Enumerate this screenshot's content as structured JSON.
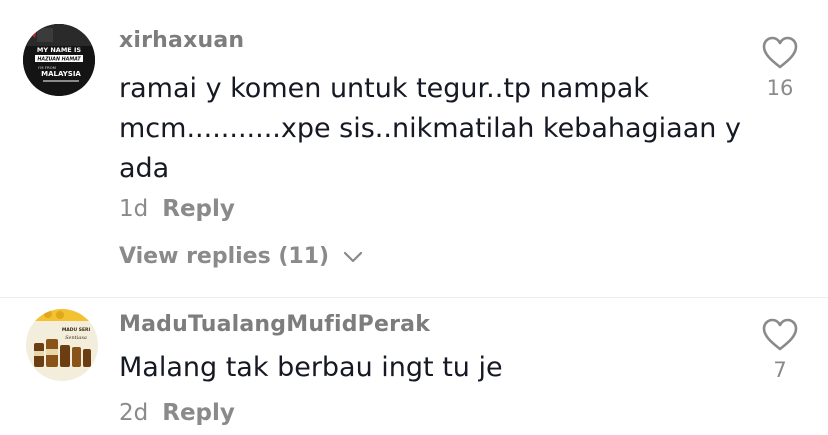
{
  "comments": [
    {
      "username": "xirhaxuan",
      "lines": [
        "ramai y komen untuk tegur..tp nampak",
        "mcm...........xpe sis..nikmatilah kebahagiaan y",
        "ada"
      ],
      "age": "1d",
      "reply_label": "Reply",
      "view_replies_label": "View replies (11)",
      "likes": "16",
      "avatar": {
        "lines": [
          "MY NAME IS",
          "HAZUAN HAMAT",
          "I'M FROM",
          "MALAYSIA"
        ]
      }
    },
    {
      "username": "MaduTualangMufidPerak",
      "lines": [
        "Malang tak berbau ingt tu je"
      ],
      "age": "2d",
      "reply_label": "Reply",
      "likes": "7",
      "avatar": {
        "lines": [
          "MADU SERI",
          "Sentiasa"
        ]
      }
    }
  ],
  "colors": {
    "text": "#161823",
    "muted": "#8a8a8a",
    "username": "#7d7d7d",
    "divider": "#ededed"
  },
  "icons": {
    "like": "heart-outline-icon",
    "expand": "chevron-down-icon"
  }
}
